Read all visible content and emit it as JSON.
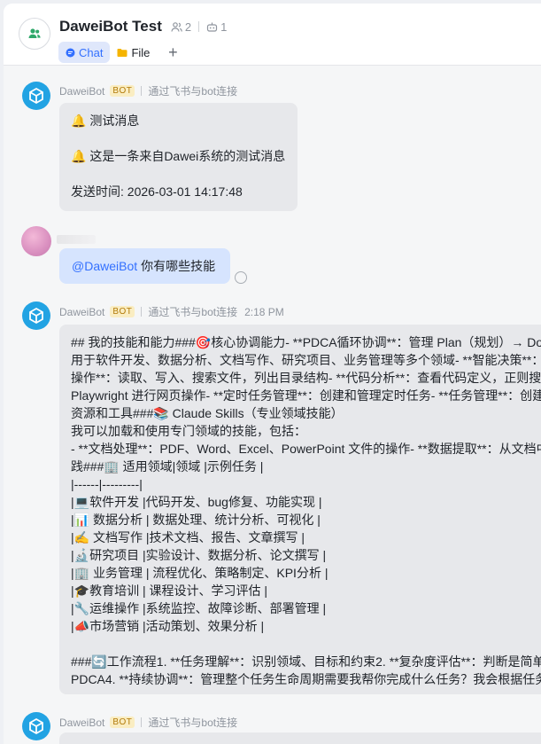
{
  "header": {
    "title": "DaweiBot Test",
    "member_count": "2",
    "bot_count": "1",
    "tabs": [
      {
        "label": "Chat"
      },
      {
        "label": "File"
      }
    ],
    "add_tab": "+"
  },
  "messages": [
    {
      "sender": "DaweiBot",
      "badge": "BOT",
      "via": "通过飞书与bot连接",
      "time": "",
      "lines": [
        "🔔 测试消息",
        "",
        "🔔 这是一条来自Dawei系统的测试消息",
        "",
        "发送时间: 2026-03-01 14:17:48"
      ]
    },
    {
      "mention": "@DaweiBot",
      "text": "你有哪些技能"
    },
    {
      "sender": "DaweiBot",
      "badge": "BOT",
      "via": "通过飞书与bot连接",
      "time": "2:18 PM",
      "lines": [
        "## 我的技能和能力###🎯核心协调能力- **PDCA循环协调**：管理 Plan（规划）→ Do（执行）→ Check（检查）→ Act（改进）",
        "用于软件开发、数据分析、文档写作、研究项目、业务管理等多个领域- **智能决策**：",
        "操作**：读取、写入、搜索文件，列出目录结构- **代码分析**：查看代码定义，正则搜索",
        "Playwright 进行网页操作- **定时任务管理**：创建和管理定时任务- **任务管理**：创建",
        "资源和工具###📚 Claude Skills（专业领域技能）",
        "我可以加载和使用专门领域的技能，包括：",
        "- **文档处理**：PDF、Word、Excel、PowerPoint 文件的操作- **数据提取**：从文档中",
        "践###🏢 适用领域|领域 |示例任务 |",
        "|------|---------|",
        "|💻软件开发 |代码开发、bug修复、功能实现 |",
        "|📊 数据分析 | 数据处理、统计分析、可视化 |",
        "|✍️ 文档写作 |技术文档、报告、文章撰写 |",
        "|🔬研究项目 |实验设计、数据分析、论文撰写 |",
        "|🏢 业务管理 | 流程优化、策略制定、KPI分析 |",
        "|🎓教育培训 | 课程设计、学习评估 |",
        "|🔧运维操作 |系统监控、故障诊断、部署管理 |",
        "|📣市场营销 |活动策划、效果分析 |",
        "",
        "###🔄工作流程1. **任务理解**：识别领域、目标和约束2. **复杂度评估**：判断是简单",
        "PDCA4. **持续协调**：管理整个任务生命周期需要我帮你完成什么任务？我会根据任务"
      ]
    },
    {
      "sender": "DaweiBot",
      "badge": "BOT",
      "via": "通过飞书与bot连接",
      "time": ""
    }
  ],
  "colors": {
    "accent": "#3370ff",
    "bot_avatar": "#22a3e3",
    "bot_badge_bg": "#faedc2",
    "bubble_bot": "#e7e8eb",
    "bubble_me": "#d6e4fe"
  },
  "icons": {
    "group": "group-people-icon",
    "members": "members-icon",
    "bot": "robot-icon",
    "chat": "chat-bubble-icon",
    "file": "folder-icon",
    "bot_avatar": "bot-logo-icon",
    "read_status": "read-status-circle-icon"
  }
}
